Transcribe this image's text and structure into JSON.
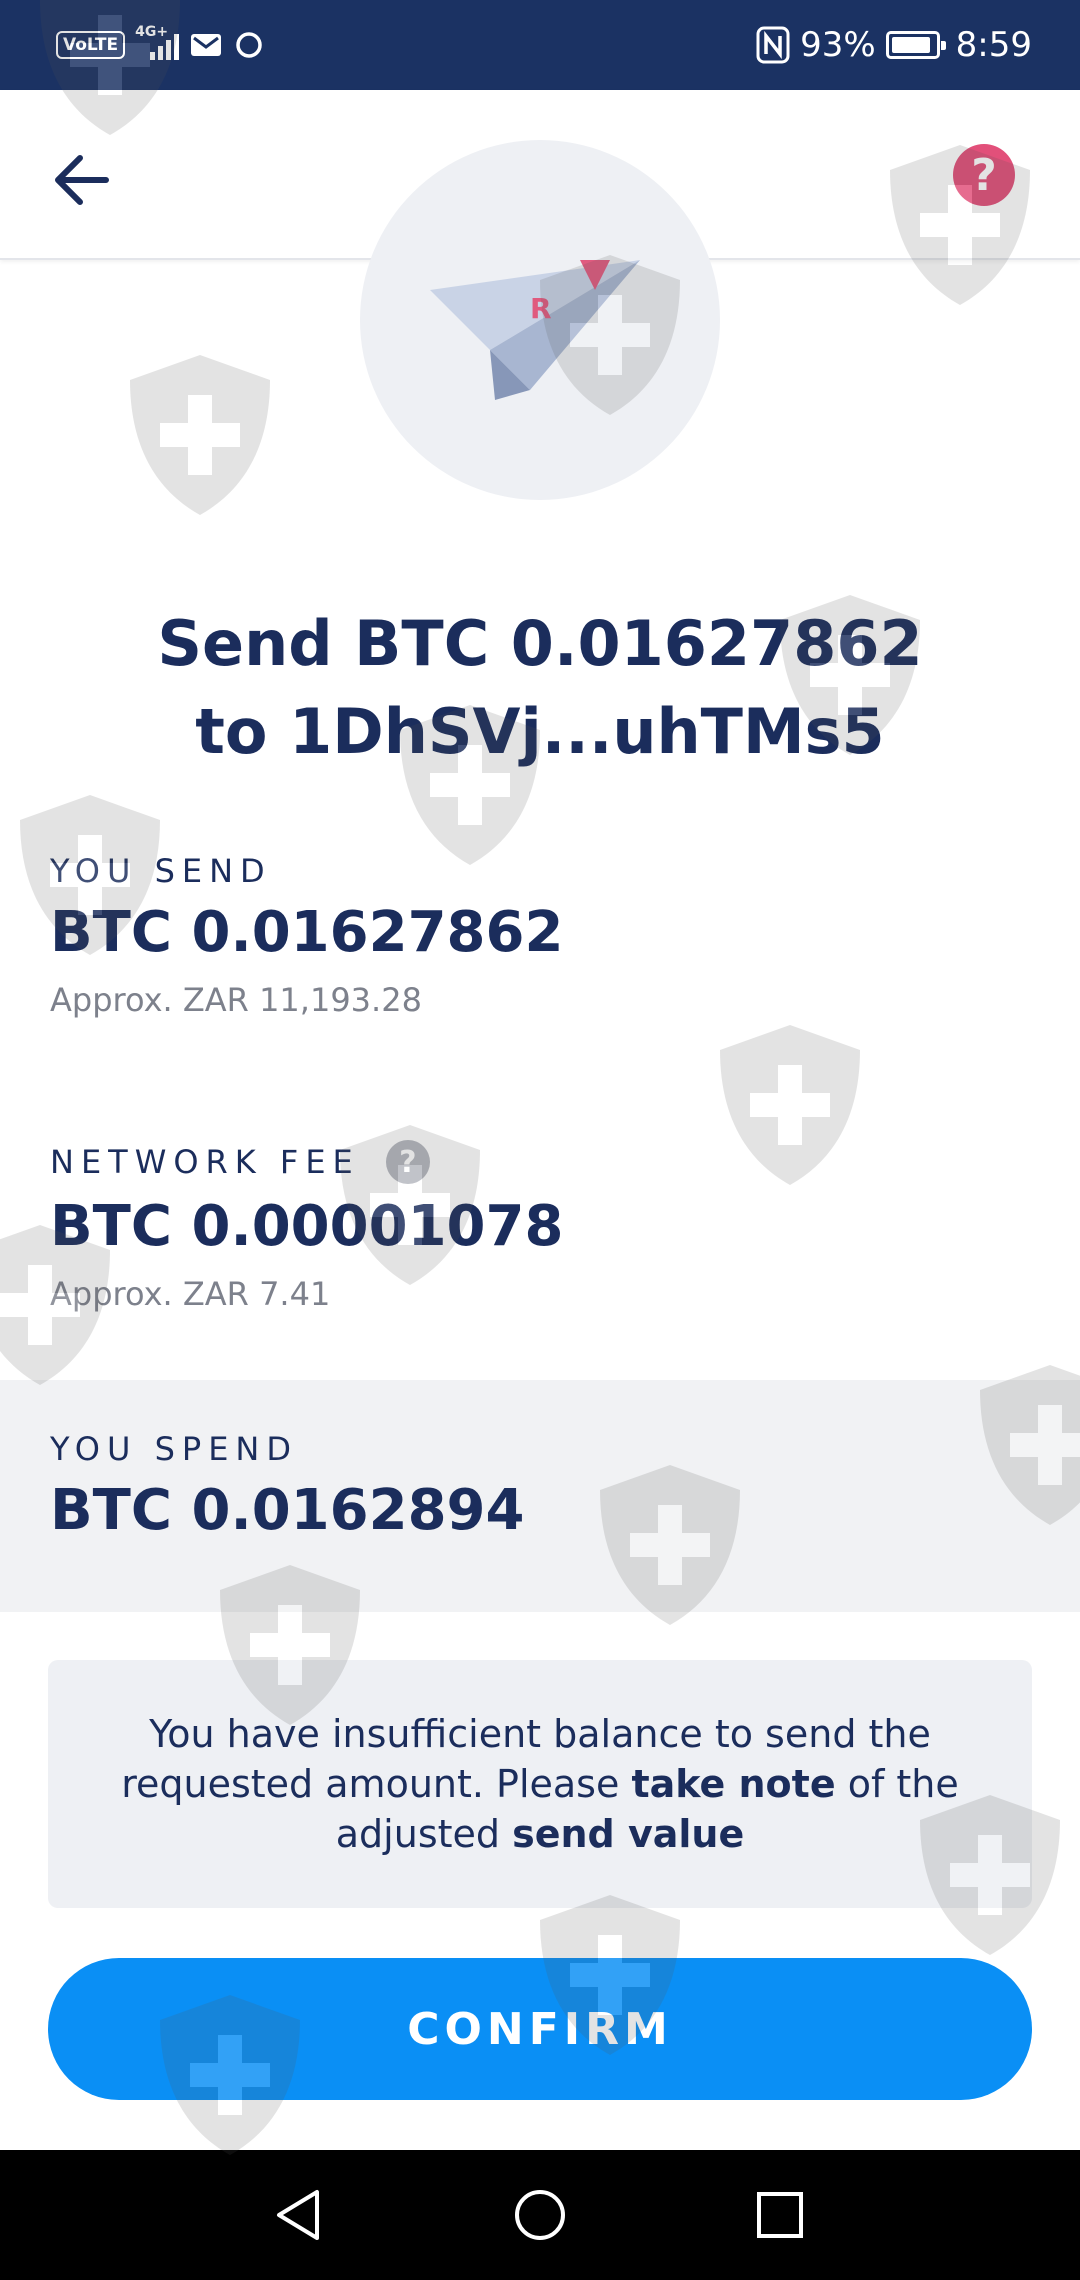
{
  "status_bar": {
    "volte": "VoLTE",
    "network": "4G+",
    "battery": "93%",
    "time": "8:59",
    "icons": [
      "volte-icon",
      "signal-icon",
      "mail-icon",
      "circle-icon",
      "nfc-icon",
      "battery-icon"
    ]
  },
  "header": {
    "back_icon": "arrow-left-icon",
    "help_label": "?"
  },
  "title": {
    "line1": "Send BTC 0.01627862",
    "line2": "to 1DhSVj...uhTMs5"
  },
  "you_send": {
    "label": "YOU SEND",
    "value": "BTC 0.01627862",
    "approx": "Approx. ZAR 11,193.28"
  },
  "network_fee": {
    "label": "NETWORK FEE",
    "help_label": "?",
    "value": "BTC 0.00001078",
    "approx": "Approx. ZAR 7.41"
  },
  "you_spend": {
    "label": "YOU SPEND",
    "value": "BTC 0.0162894"
  },
  "notice": {
    "part1": "You have insufficient balance to send the requested amount. Please ",
    "bold1": "take note",
    "part2": " of the adjusted ",
    "bold2": "send value"
  },
  "confirm_label": "CONFIRM",
  "colors": {
    "status_bar": "#1b3263",
    "primary_text": "#1b2d5c",
    "accent_button": "#0a8ff5",
    "help_badge": "#e2507a",
    "panel": "#eef0f4"
  }
}
